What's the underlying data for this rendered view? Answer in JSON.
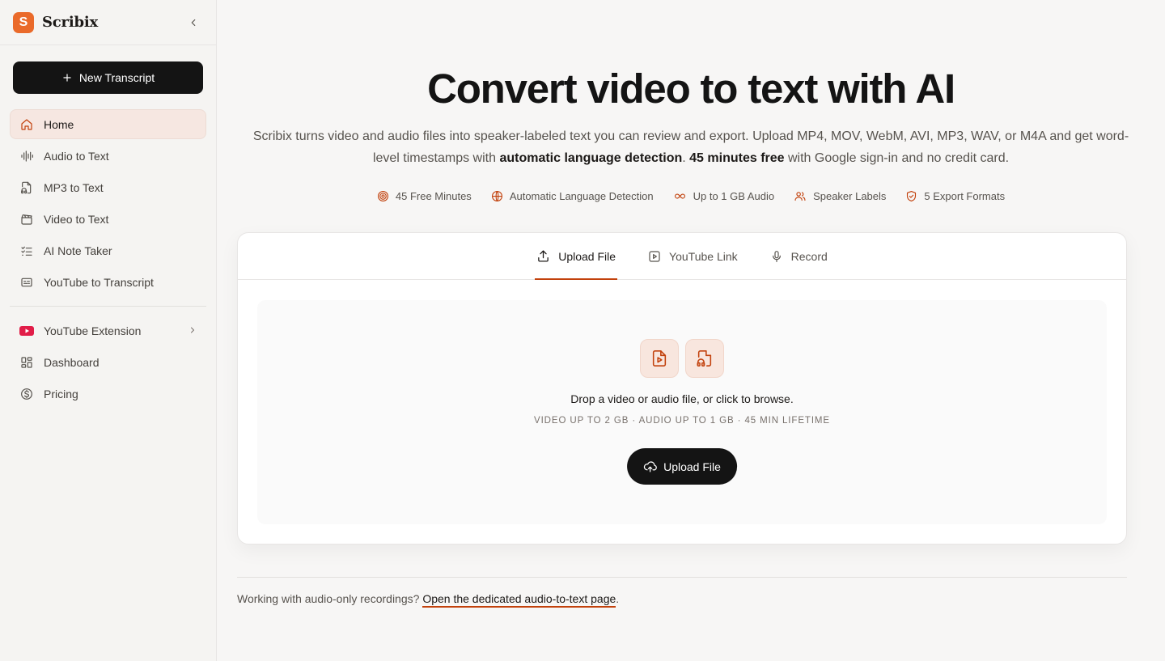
{
  "brand": {
    "logo_letter": "S",
    "name": "Scribix"
  },
  "sidebar": {
    "new_button": "New Transcript",
    "items": [
      {
        "label": "Home",
        "icon": "home-icon",
        "active": true
      },
      {
        "label": "Audio to Text",
        "icon": "waveform-icon"
      },
      {
        "label": "MP3 to Text",
        "icon": "file-headphones-icon"
      },
      {
        "label": "Video to Text",
        "icon": "clapperboard-icon"
      },
      {
        "label": "AI Note Taker",
        "icon": "checklist-icon"
      },
      {
        "label": "YouTube to Transcript",
        "icon": "captions-icon"
      }
    ],
    "secondary": [
      {
        "label": "YouTube Extension",
        "icon": "youtube-icon",
        "has_chevron": true
      },
      {
        "label": "Dashboard",
        "icon": "dashboard-icon"
      },
      {
        "label": "Pricing",
        "icon": "dollar-circle-icon"
      }
    ]
  },
  "hero": {
    "title": "Convert video to text with AI",
    "sub_part1": "Scribix turns video and audio files into speaker-labeled text you can review and export. Upload MP4, MOV, WebM, AVI, MP3, WAV, or M4A and get word-level timestamps with ",
    "sub_bold1": "automatic language detection",
    "sub_part2": ". ",
    "sub_bold2": "45 minutes free",
    "sub_part3": " with Google sign-in and no credit card."
  },
  "features": [
    {
      "label": "45 Free Minutes",
      "icon": "target-icon"
    },
    {
      "label": "Automatic Language Detection",
      "icon": "globe-icon"
    },
    {
      "label": "Up to 1 GB Audio",
      "icon": "infinity-icon"
    },
    {
      "label": "Speaker Labels",
      "icon": "users-icon"
    },
    {
      "label": "5 Export Formats",
      "icon": "shield-check-icon"
    }
  ],
  "tabs": [
    {
      "label": "Upload File",
      "icon": "upload-icon",
      "active": true
    },
    {
      "label": "YouTube Link",
      "icon": "play-square-icon"
    },
    {
      "label": "Record",
      "icon": "microphone-icon"
    }
  ],
  "dropzone": {
    "text": "Drop a video or audio file, or click to browse.",
    "limits": "VIDEO UP TO 2 GB · AUDIO UP TO 1 GB · 45 MIN LIFETIME",
    "button": "Upload File"
  },
  "footer": {
    "text": "Working with audio-only recordings? ",
    "link": "Open the dedicated audio-to-text page",
    "suffix": "."
  },
  "colors": {
    "accent": "#c2410c",
    "brand": "#ea6a2a",
    "dark": "#141414",
    "youtube": "#e11d48"
  }
}
